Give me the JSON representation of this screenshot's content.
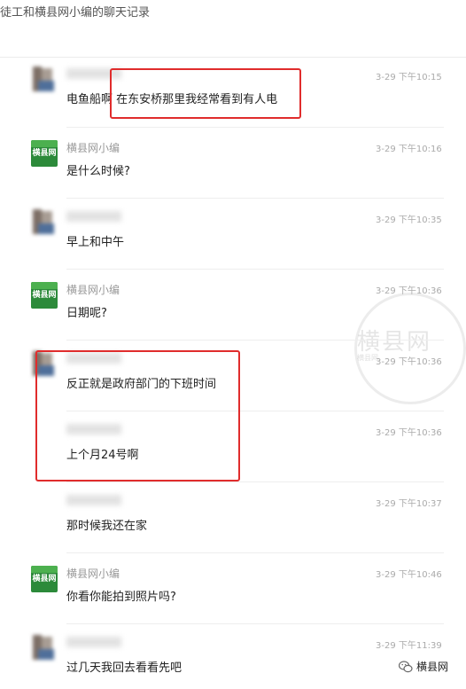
{
  "header": {
    "title": "徒工和横县网小编的聊天记录"
  },
  "watermark": {
    "text": "横县网",
    "subtext": "横县网"
  },
  "footer": {
    "label": "横县网"
  },
  "colors": {
    "highlight": "#e02c2c",
    "bot_avatar": "#2c8a3a"
  },
  "messages": [
    {
      "sender": "",
      "avatar": "user-avatar-icon",
      "time": "3-29 下午10:15",
      "text": "电鱼船啊 在东安桥那里我经常看到有人电"
    },
    {
      "sender": "横县网小编",
      "avatar": "bot-avatar-icon",
      "avatar_text": "横县网",
      "time": "3-29 下午10:16",
      "text": "是什么时候?"
    },
    {
      "sender": "",
      "avatar": "user-avatar-icon",
      "time": "3-29 下午10:35",
      "text": "早上和中午"
    },
    {
      "sender": "横县网小编",
      "avatar": "bot-avatar-icon",
      "avatar_text": "横县网",
      "time": "3-29 下午10:36",
      "text": "日期呢?"
    },
    {
      "sender": "",
      "avatar": "user-avatar-icon",
      "time": "3-29 下午10:36",
      "text": "反正就是政府部门的下班时间"
    },
    {
      "sender": "",
      "avatar": "",
      "time": "3-29 下午10:36",
      "text": "上个月24号啊"
    },
    {
      "sender": "",
      "avatar": "",
      "time": "3-29 下午10:37",
      "text": "那时候我还在家"
    },
    {
      "sender": "横县网小编",
      "avatar": "bot-avatar-icon",
      "avatar_text": "横县网",
      "time": "3-29 下午10:46",
      "text": "你看你能拍到照片吗?"
    },
    {
      "sender": "",
      "avatar": "user-avatar-icon",
      "time": "3-29 下午11:39",
      "text": "过几天我回去看看先吧"
    }
  ]
}
